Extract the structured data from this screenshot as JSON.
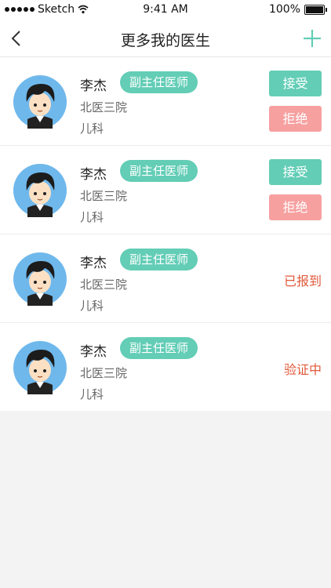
{
  "status_bar": {
    "carrier": "Sketch",
    "time": "9:41 AM",
    "battery": "100%"
  },
  "nav": {
    "title": "更多我的医生"
  },
  "colors": {
    "accent": "#63cdb6",
    "reject": "#f7a0a0",
    "status": "#e0593a"
  },
  "doctors": [
    {
      "name": "李杰",
      "title": "副主任医师",
      "hospital": "北医三院",
      "department": "儿科",
      "accept_label": "接受",
      "reject_label": "拒绝"
    },
    {
      "name": "李杰",
      "title": "副主任医师",
      "hospital": "北医三院",
      "department": "儿科",
      "accept_label": "接受",
      "reject_label": "拒绝"
    },
    {
      "name": "李杰",
      "title": "副主任医师",
      "hospital": "北医三院",
      "department": "儿科",
      "status": "已报到"
    },
    {
      "name": "李杰",
      "title": "副主任医师",
      "hospital": "北医三院",
      "department": "儿科",
      "status": "验证中"
    }
  ]
}
